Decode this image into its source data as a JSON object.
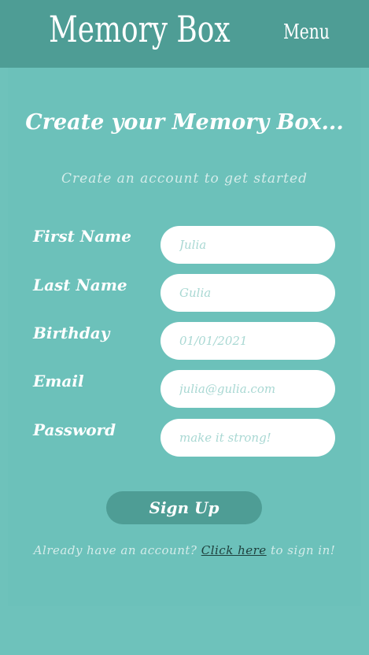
{
  "header": {
    "logo": "Memory Box",
    "menu_label": "Menu"
  },
  "main": {
    "title": "Create your Memory Box...",
    "subtitle": "Create an account to get started"
  },
  "form": {
    "fields": [
      {
        "label": "First Name",
        "placeholder": "Julia"
      },
      {
        "label": "Last Name",
        "placeholder": "Gulia"
      },
      {
        "label": "Birthday",
        "placeholder": "01/01/2021"
      },
      {
        "label": "Email",
        "placeholder": "julia@gulia.com"
      },
      {
        "label": "Password",
        "placeholder": "make it strong!"
      }
    ],
    "submit_label": "Sign Up"
  },
  "footer": {
    "prefix": "Already have an account?",
    "link_text": "Click here",
    "suffix": "to sign in!"
  },
  "colors": {
    "background": "#6ec2bb",
    "header": "#4e9d95",
    "button": "#4e9d95",
    "input_text": "#a9d8d3"
  }
}
